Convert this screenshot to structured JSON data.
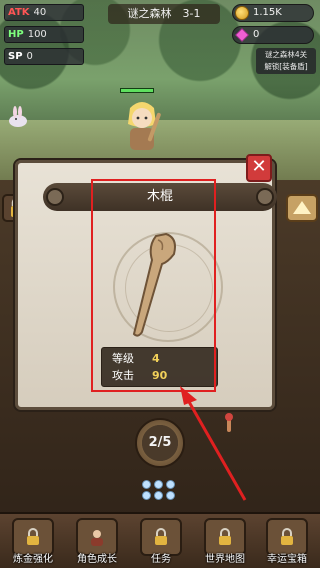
{
  "hud": {
    "atk": {
      "key": "ATK",
      "value": "40"
    },
    "hp": {
      "key": "HP",
      "value": "100"
    },
    "sp": {
      "key": "SP",
      "value": "0"
    },
    "level_title": "谜之森林　3-1",
    "coins": "1.15K",
    "gems": "0",
    "unlock_note": "谜之森林4关\n解锁[装备盾]"
  },
  "hero": {
    "health_fraction": 1.0
  },
  "item_panel": {
    "title": "木棍",
    "close_label": "✕",
    "stats": [
      {
        "label": "等级",
        "value": "4"
      },
      {
        "label": "攻击",
        "value": "90"
      }
    ]
  },
  "pager": {
    "text": "2/5"
  },
  "bottom_nav": [
    {
      "label": "炼金强化",
      "icon": "lock-icon"
    },
    {
      "label": "角色成长",
      "icon": "character-icon"
    },
    {
      "label": "任务",
      "icon": "lock-icon"
    },
    {
      "label": "世界地图",
      "icon": "lock-icon"
    },
    {
      "label": "幸运宝箱",
      "icon": "lock-icon"
    }
  ],
  "colors": {
    "highlight": "#e02020",
    "atk": "#ff5555",
    "hp": "#7dff7d",
    "close": "#d13b3b"
  }
}
